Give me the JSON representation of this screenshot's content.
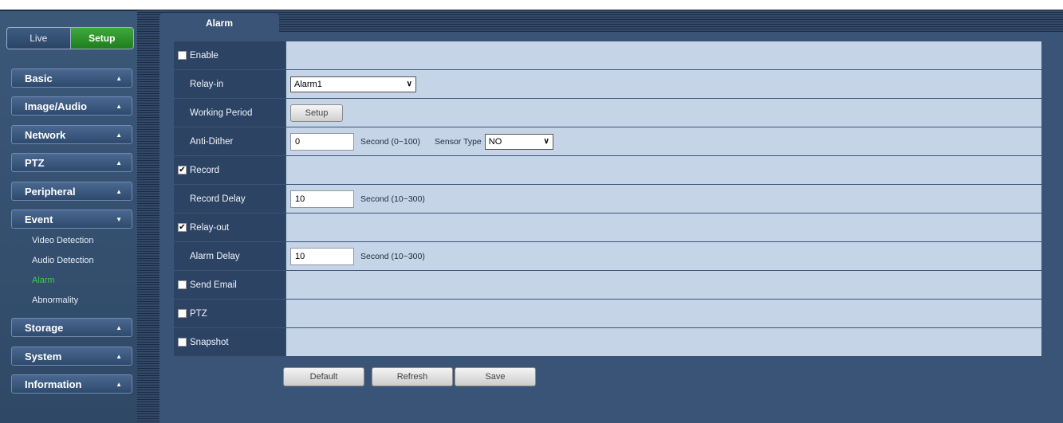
{
  "mode": {
    "live_label": "Live",
    "setup_label": "Setup"
  },
  "sidebar": {
    "menu": [
      {
        "label": "Basic"
      },
      {
        "label": "Image/Audio"
      },
      {
        "label": "Network"
      },
      {
        "label": "PTZ"
      },
      {
        "label": "Peripheral"
      },
      {
        "label": "Event"
      },
      {
        "label": "Storage"
      },
      {
        "label": "System"
      },
      {
        "label": "Information"
      }
    ],
    "event_sub": [
      {
        "label": "Video Detection"
      },
      {
        "label": "Audio Detection"
      },
      {
        "label": "Alarm"
      },
      {
        "label": "Abnormality"
      }
    ]
  },
  "tab": {
    "label": "Alarm"
  },
  "form": {
    "enable": {
      "label": "Enable",
      "checked": false
    },
    "relay_in": {
      "label": "Relay-in",
      "value": "Alarm1"
    },
    "working_period": {
      "label": "Working Period",
      "button": "Setup"
    },
    "anti_dither": {
      "label": "Anti-Dither",
      "value": "0",
      "unit": "Second (0~100)",
      "sensor_label": "Sensor Type",
      "sensor_value": "NO"
    },
    "record": {
      "label": "Record",
      "checked": true
    },
    "record_delay": {
      "label": "Record Delay",
      "value": "10",
      "unit": "Second (10~300)"
    },
    "relay_out": {
      "label": "Relay-out",
      "checked": true
    },
    "alarm_delay": {
      "label": "Alarm Delay",
      "value": "10",
      "unit": "Second (10~300)"
    },
    "send_email": {
      "label": "Send Email",
      "checked": false
    },
    "ptz": {
      "label": "PTZ",
      "checked": false
    },
    "snapshot": {
      "label": "Snapshot",
      "checked": false
    }
  },
  "buttons": {
    "default": "Default",
    "refresh": "Refresh",
    "save": "Save"
  },
  "colors": {
    "accent_green": "#39d339",
    "panel_bg": "#3a5478",
    "label_bg": "#2c4364",
    "value_bg": "#c5d4e7"
  }
}
